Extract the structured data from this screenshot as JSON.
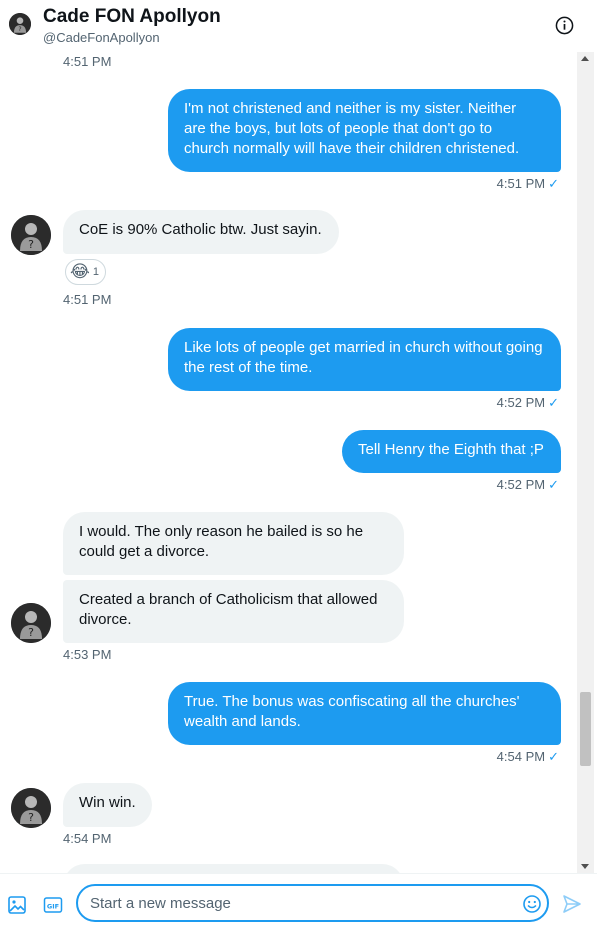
{
  "header": {
    "title": "Cade FON Apollyon",
    "handle": "@CadeFonApollyon",
    "info_icon": "info-icon"
  },
  "messages": [
    {
      "id": "m0",
      "direction": "received",
      "time": "4:51 PM",
      "partial": true
    },
    {
      "id": "m1",
      "direction": "sent",
      "text": "I'm not christened and neither is my sister. Neither\nare the boys, but lots of people that don't go to\nchurch normally will have their children christened.",
      "time": "4:51 PM",
      "status_icon": "check-icon"
    },
    {
      "id": "m2",
      "direction": "received",
      "text": "CoE is 90% Catholic btw. Just sayin.",
      "time": "4:51 PM",
      "reaction": {
        "emoji": "😂",
        "count": "1"
      }
    },
    {
      "id": "m3",
      "direction": "sent",
      "text": "Like lots of people get married in church without going\nthe rest of the time.",
      "time": "4:52 PM",
      "status_icon": "check-icon"
    },
    {
      "id": "m4",
      "direction": "sent",
      "text": "Tell Henry the Eighth that ;P",
      "time": "4:52 PM",
      "status_icon": "check-icon"
    },
    {
      "id": "m5",
      "direction": "received",
      "text": "I would. The only reason he bailed is so he\ncould get a divorce."
    },
    {
      "id": "m6",
      "direction": "received",
      "text": "Created a branch of Catholicism that allowed\ndivorce.",
      "time": "4:53 PM"
    },
    {
      "id": "m7",
      "direction": "sent",
      "text": "True. The bonus was confiscating all the churches'\nwealth and lands.",
      "time": "4:54 PM",
      "status_icon": "check-icon"
    },
    {
      "id": "m8",
      "direction": "received",
      "text": "Win win.",
      "time": "4:54 PM"
    }
  ],
  "composer": {
    "placeholder": "Start a new message",
    "media_icon": "image-icon",
    "gif_label": "GIF",
    "emoji_icon": "emoji-icon",
    "send_icon": "send-icon"
  },
  "colors": {
    "accent": "#1d9bf0",
    "received_bubble": "#eff3f4",
    "secondary_text": "#536471"
  }
}
